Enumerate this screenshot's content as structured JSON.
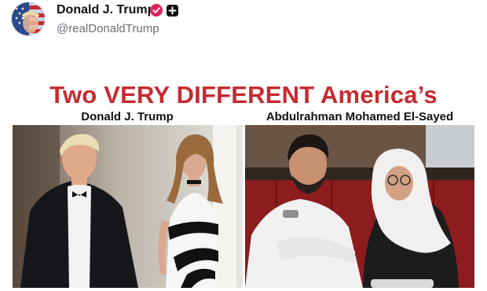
{
  "post": {
    "author_name": "Donald J. Trump",
    "handle": "@realDonaldTrump",
    "verified_color": "#e0245e",
    "icons": [
      "flag-avatar",
      "verified-badge-icon",
      "add-icon"
    ]
  },
  "meme": {
    "title": "Two VERY DIFFERENT America’s",
    "title_color": "#c62a2f",
    "left_label": "Donald J. Trump",
    "right_label": "Abdulrahman Mohamed El-Sayed"
  }
}
